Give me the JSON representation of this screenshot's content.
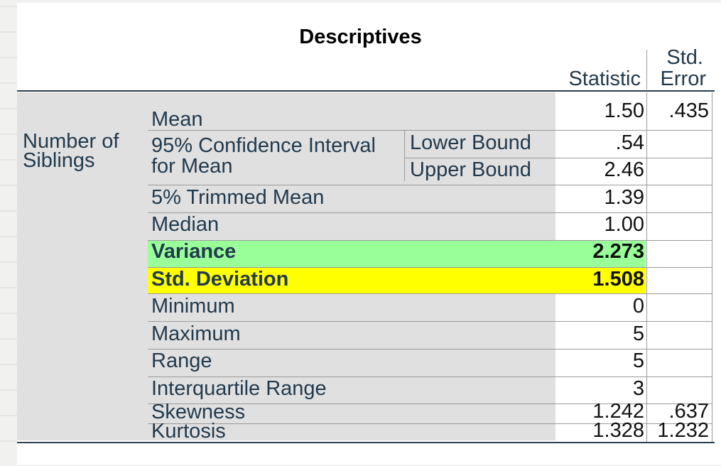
{
  "title": "Descriptives",
  "columns": {
    "statistic": "Statistic",
    "std_error_line1": "Std.",
    "std_error_line2": "Error"
  },
  "variable": {
    "line1": "Number of",
    "line2": "Siblings"
  },
  "ci": {
    "line1": "95% Confidence Interval",
    "line2": "for Mean",
    "lower": "Lower Bound",
    "upper": "Upper Bound"
  },
  "rows": {
    "mean": {
      "label": "Mean",
      "statistic": "1.50",
      "std_error": ".435"
    },
    "lower_bound": {
      "statistic": ".54"
    },
    "upper_bound": {
      "statistic": "2.46"
    },
    "trimmed_mean": {
      "label": "5% Trimmed Mean",
      "statistic": "1.39"
    },
    "median": {
      "label": "Median",
      "statistic": "1.00"
    },
    "variance": {
      "label": "Variance",
      "statistic": "2.273"
    },
    "std_deviation": {
      "label": "Std. Deviation",
      "statistic": "1.508"
    },
    "minimum": {
      "label": "Minimum",
      "statistic": "0"
    },
    "maximum": {
      "label": "Maximum",
      "statistic": "5"
    },
    "range": {
      "label": "Range",
      "statistic": "5"
    },
    "iqr": {
      "label": "Interquartile Range",
      "statistic": "3"
    },
    "skewness": {
      "label": "Skewness",
      "statistic": "1.242",
      "std_error": ".637"
    },
    "kurtosis": {
      "label": "Kurtosis",
      "statistic": "1.328",
      "std_error": "1.232"
    }
  },
  "colors": {
    "variance_highlight": "#99ff99",
    "std_deviation_highlight": "#ffff00",
    "label_text": "#223a4d"
  }
}
